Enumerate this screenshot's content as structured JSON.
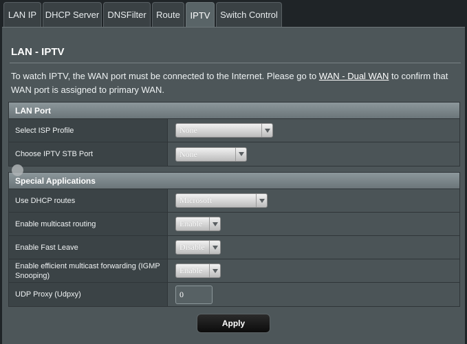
{
  "tabs": [
    {
      "label": "LAN IP",
      "active": false
    },
    {
      "label": "DHCP Server",
      "active": false
    },
    {
      "label": "DNSFilter",
      "active": false
    },
    {
      "label": "Route",
      "active": false
    },
    {
      "label": "IPTV",
      "active": true
    },
    {
      "label": "Switch Control",
      "active": false
    }
  ],
  "page": {
    "title": "LAN - IPTV",
    "intro_before": "To watch IPTV, the WAN port must be connected to the Internet. Please go to ",
    "intro_link": "WAN - Dual WAN",
    "intro_after": " to confirm that WAN port is assigned to primary WAN."
  },
  "lan_port": {
    "header": "LAN Port",
    "isp_profile": {
      "label": "Select ISP Profile",
      "value": "None"
    },
    "stb_port": {
      "label": "Choose IPTV STB Port",
      "value": "None"
    }
  },
  "special": {
    "header": "Special Applications",
    "dhcp_routes": {
      "label": "Use DHCP routes",
      "value": "Microsoft"
    },
    "multicast_routing": {
      "label": "Enable multicast routing",
      "value": "Enable"
    },
    "fast_leave": {
      "label": "Enable Fast Leave",
      "value": "Disable"
    },
    "igmp_snooping": {
      "label": "Enable efficient multicast forwarding (IGMP Snooping)",
      "value": "Enable"
    },
    "udpxy": {
      "label": "UDP Proxy (Udpxy)",
      "value": "0"
    }
  },
  "apply_label": "Apply",
  "colors": {
    "panel": "#4d5659",
    "header": "#7a858a",
    "button": "#111111"
  }
}
